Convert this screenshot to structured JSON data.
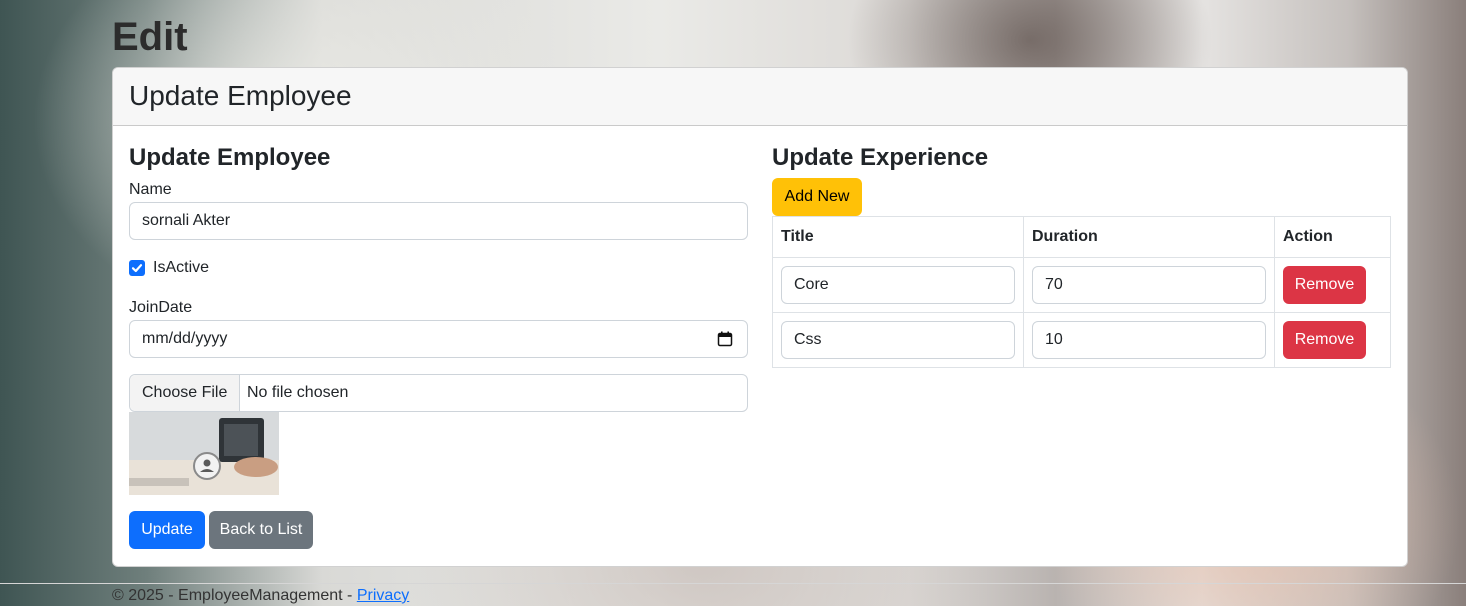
{
  "page": {
    "heading": "Edit"
  },
  "card": {
    "header_title": "Update Employee"
  },
  "employee_form": {
    "section_title": "Update Employee",
    "name_label": "Name",
    "name_value": "sornali Akter",
    "is_active_label": "IsActive",
    "is_active_checked": true,
    "join_date_label": "JoinDate",
    "join_date_placeholder": "mm/dd/yyyy",
    "file_button_label": "Choose File",
    "file_status": "No file chosen",
    "update_button": "Update",
    "back_button": "Back to List"
  },
  "experience": {
    "section_title": "Update Experience",
    "add_button": "Add New",
    "columns": [
      "Title",
      "Duration",
      "Action"
    ],
    "rows": [
      {
        "title": "Core",
        "duration": "70",
        "action": "Remove"
      },
      {
        "title": "Css",
        "duration": "10",
        "action": "Remove"
      }
    ]
  },
  "footer": {
    "text": "© 2025 - EmployeeManagement - ",
    "privacy_link": "Privacy"
  },
  "colors": {
    "primary": "#0d6efd",
    "secondary": "#6c757d",
    "warning": "#ffc107",
    "danger": "#dc3545"
  }
}
